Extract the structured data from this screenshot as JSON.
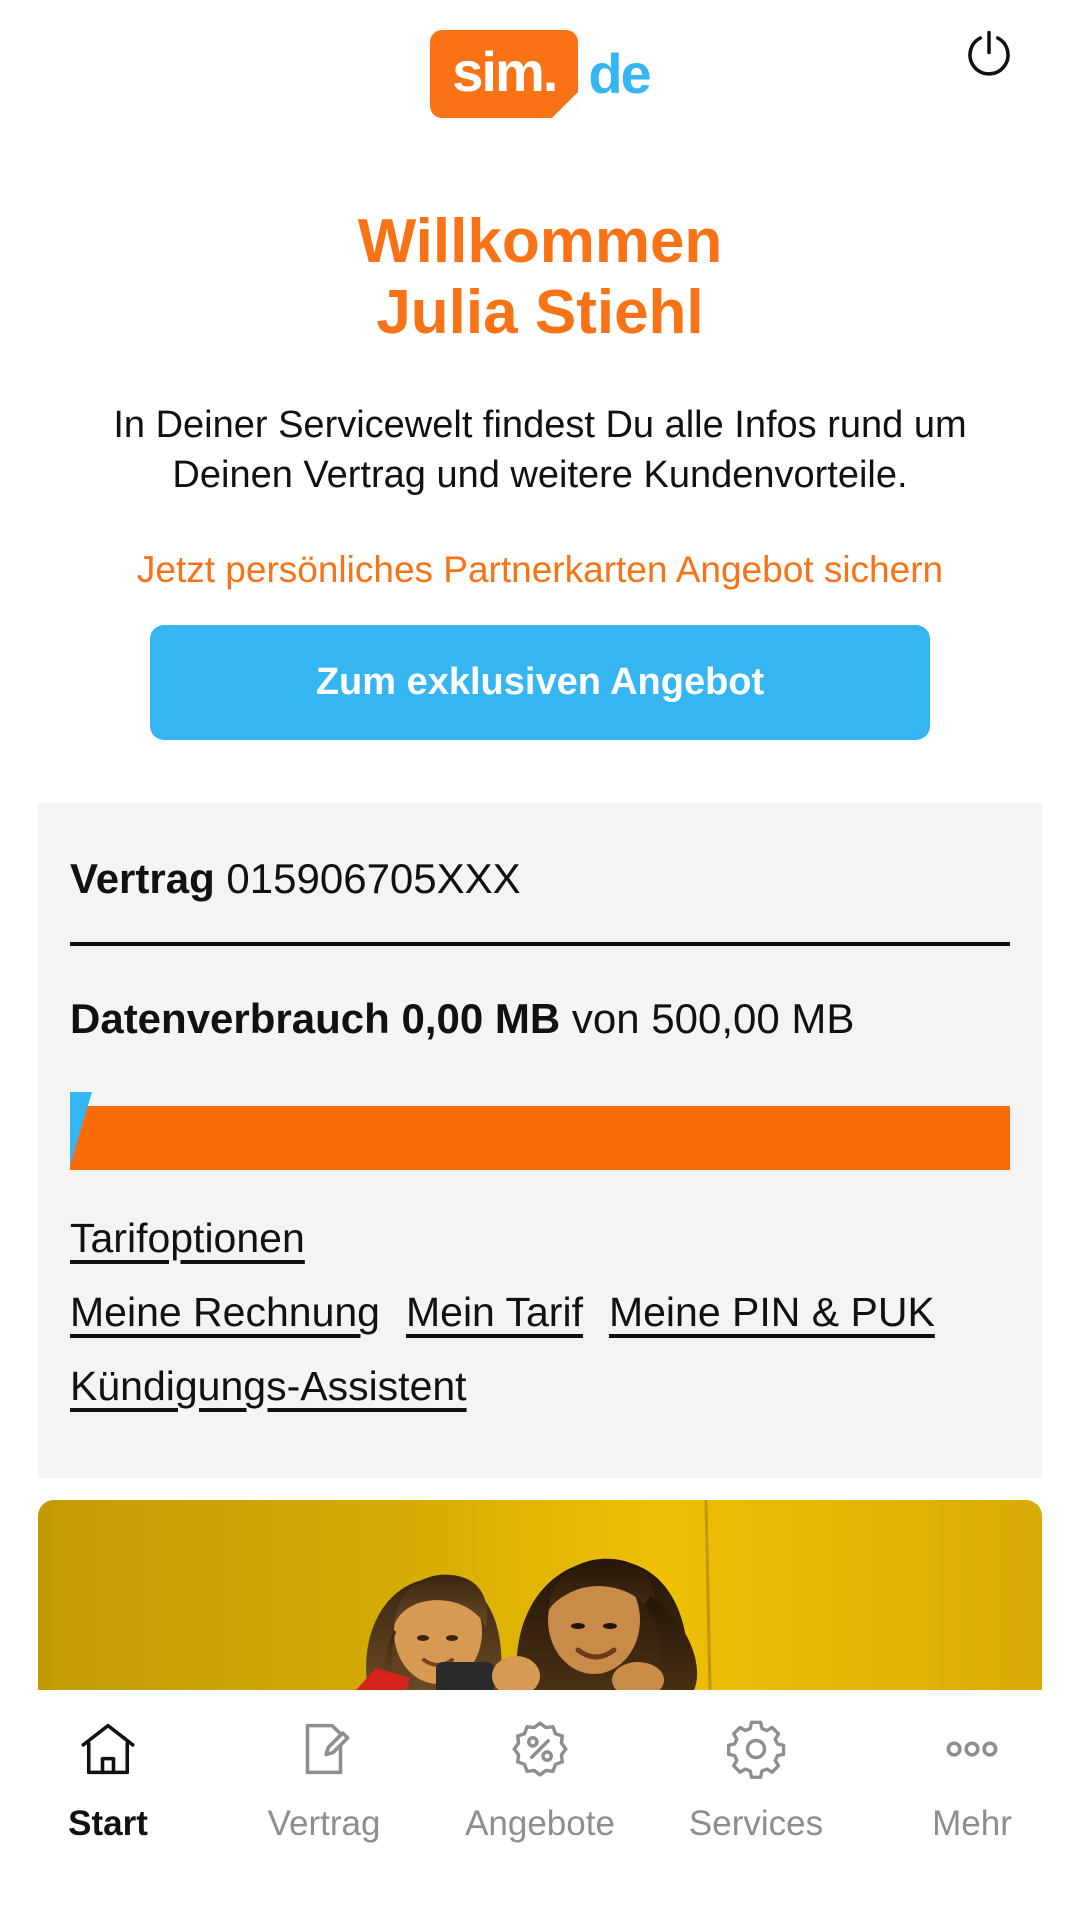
{
  "header": {
    "logo_main": "sim.",
    "logo_tld": "de",
    "power_icon": "power-icon"
  },
  "welcome": {
    "line1": "Willkommen",
    "line2": "Julia Stiehl"
  },
  "intro": {
    "text": "In Deiner Servicewelt findest Du alle Infos rund um Deinen Vertrag und weitere Kundenvorteile."
  },
  "promo": {
    "text": "Jetzt persönliches Partnerkarten Angebot sichern",
    "cta_label": "Zum exklusiven Angebot"
  },
  "contract_card": {
    "contract_label": "Vertrag",
    "contract_number": "015906705XXX",
    "usage_label": "Datenverbrauch",
    "usage_value": "0,00 MB",
    "usage_separator": "von",
    "usage_total": "500,00 MB",
    "usage_percent": 0,
    "links_row1": [
      "Tarifoptionen"
    ],
    "links_row2": [
      "Meine Rechnung",
      "Mein Tarif",
      "Meine PIN & PUK"
    ],
    "links_row3": [
      "Kündigungs-Assistent"
    ]
  },
  "banner": {
    "alt": "Zwei lachende Frauen schauen gemeinsam auf ein Smartphone"
  },
  "bottom_nav": {
    "items": [
      {
        "label": "Start",
        "icon": "home-icon",
        "active": true
      },
      {
        "label": "Vertrag",
        "icon": "contract-edit-icon",
        "active": false
      },
      {
        "label": "Angebote",
        "icon": "percent-badge-icon",
        "active": false
      },
      {
        "label": "Services",
        "icon": "gear-icon",
        "active": false
      },
      {
        "label": "Mehr",
        "icon": "more-dots-icon",
        "active": false
      }
    ]
  },
  "colors": {
    "brand_orange": "#f97316",
    "brand_blue": "#35b6f2",
    "bar_orange": "#f96a08",
    "card_bg": "#f4f4f4",
    "text": "#111111",
    "muted": "#8e8e8e"
  }
}
